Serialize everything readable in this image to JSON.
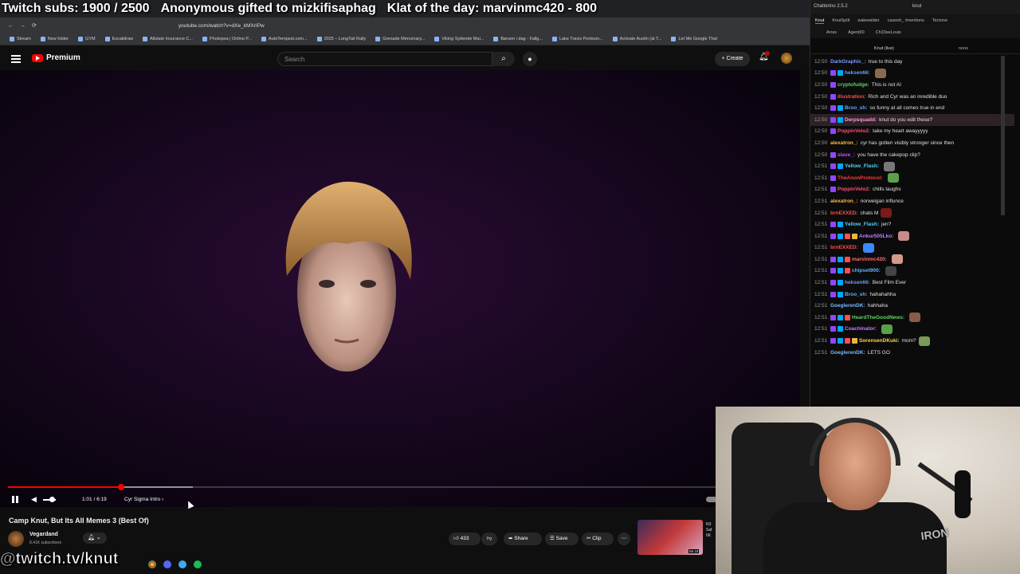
{
  "overlay": {
    "subs": "Twitch subs: 1900 / 2500",
    "gift": "Anonymous gifted to mizkifisaphag",
    "klat": "Klat of the day: marvinmc420 - 800"
  },
  "browser": {
    "url": "youtube.com/watch?v=dXe_kMXrIPw",
    "bookmarks": [
      "Stream",
      "New folder",
      "GYM",
      "Excalidraw",
      "Allstate Insurance C...",
      "Photopea | Online P...",
      "AutoTempest.com...",
      "2025 – LongTail Rally",
      "Grenade Mercenary...",
      "Viking Syttende Mai...",
      "Børsen i dag - Fallg...",
      "Lake Travis Pontoon...",
      "Activate Austin (at T...",
      "Let Me Google That"
    ]
  },
  "youtube": {
    "logo_text": "Premium",
    "search_placeholder": "Search",
    "create_label": "Create",
    "time": "1:01 / 6:19",
    "chapter": "Cyr Sigma Intro",
    "chapter_arrow": "›",
    "progress_fraction": 0.16,
    "title": "Camp Knut, But Its All Memes 3 (Best Of)",
    "channel": "Vegardand",
    "subscribers": "8.41K subscribers",
    "likes": "433",
    "share": "Share",
    "save": "Save",
    "clip": "Clip",
    "next_duration": "55:18",
    "next_label": "N3\nSaf\n6K"
  },
  "watermark": "@twitch.tv/knut",
  "chat": {
    "app_title": "Chatterino 2.5.2",
    "top_channel": "knut",
    "tabs": [
      "Knut",
      "KnutSplit",
      "wakewilder",
      "caseoh_ /mentions",
      "Tectone"
    ],
    "tabs2": [
      "Arrav",
      "Agent00",
      "Ch33seLouis"
    ],
    "channel_label": "Knut (live)",
    "filter_label": "none",
    "lines": [
      {
        "ts": "12:50",
        "name": "DarkGraphic_:",
        "color": "#7a9cff",
        "msg": "true to this day",
        "badges": 0
      },
      {
        "ts": "12:50",
        "name": "heksen66:",
        "color": "#6a9dff",
        "msg": "",
        "badges": 2,
        "emote": "#8a6a4a"
      },
      {
        "ts": "12:50",
        "name": "cryptofudge:",
        "color": "#61d161",
        "msg": "This is not AI",
        "badges": 1
      },
      {
        "ts": "12:50",
        "name": "illustration:",
        "color": "#ff4d4d",
        "msg": "Rich and Cyr was an inredible duo",
        "badges": 1
      },
      {
        "ts": "12:50",
        "name": "Broo_sh:",
        "color": "#5fa8ff",
        "msg": "so funny at all comes true in end",
        "badges": 2
      },
      {
        "ts": "12:50",
        "name": "Derpsquadd:",
        "color": "#ff9ad5",
        "msg": "knut do you edit these?",
        "badges": 2,
        "hl": true
      },
      {
        "ts": "12:50",
        "name": "PoppinVelo2:",
        "color": "#ff4d6d",
        "msg": "take my heart awayyyyy",
        "badges": 1
      },
      {
        "ts": "12:50",
        "name": "alexatron_:",
        "color": "#ffb84d",
        "msg": "cyr has gotten visibly stronger since then",
        "badges": 0
      },
      {
        "ts": "12:50",
        "name": "slave_:",
        "color": "#cc4dff",
        "msg": "you have the cakepop clip?",
        "badges": 1
      },
      {
        "ts": "12:51",
        "name": "Yellow_Flash:",
        "color": "#4dd2ff",
        "msg": "",
        "badges": 2,
        "emote": "#777"
      },
      {
        "ts": "12:51",
        "name": "TheAnonProtocol:",
        "color": "#ff3b3b",
        "msg": "",
        "badges": 1,
        "emote": "#5aa04a"
      },
      {
        "ts": "12:51",
        "name": "PoppinVelo2:",
        "color": "#ff4d6d",
        "msg": "chills laughs",
        "badges": 1
      },
      {
        "ts": "12:51",
        "name": "alexatron_:",
        "color": "#ffb84d",
        "msg": "norweigan influnce",
        "badges": 0
      },
      {
        "ts": "12:51",
        "name": "brnEXXED:",
        "color": "#ff4d4d",
        "msg": "chats M",
        "badges": 0,
        "emote": "#7a1a1a"
      },
      {
        "ts": "12:51",
        "name": "Yellow_Flash:",
        "color": "#4dd2ff",
        "msg": "jen?",
        "badges": 2
      },
      {
        "ts": "12:51",
        "name": "Ankur505Lko:",
        "color": "#c27dff",
        "msg": "",
        "badges": 4,
        "emote": "#c98a8a"
      },
      {
        "ts": "12:51",
        "name": "brnEXXED:",
        "color": "#ff4d4d",
        "msg": "",
        "badges": 0,
        "emote": "#3a8aff"
      },
      {
        "ts": "12:51",
        "name": "marvinmc420:",
        "color": "#ff6b6b",
        "msg": "",
        "badges": 3,
        "emote": "#d49a8a"
      },
      {
        "ts": "12:51",
        "name": "chipset900:",
        "color": "#6ab0ff",
        "msg": "",
        "badges": 3,
        "emote": "#444"
      },
      {
        "ts": "12:51",
        "name": "heksen66:",
        "color": "#6a9dff",
        "msg": "Best Film Ever",
        "badges": 2
      },
      {
        "ts": "12:51",
        "name": "Broo_sh:",
        "color": "#5fa8ff",
        "msg": "hahahahha",
        "badges": 2
      },
      {
        "ts": "12:51",
        "name": "GoeglerenDK:",
        "color": "#7ab8ff",
        "msg": "hahhaha",
        "badges": 0
      },
      {
        "ts": "12:51",
        "name": "HeardTheGoodNews:",
        "color": "#61d161",
        "msg": "",
        "badges": 3,
        "emote": "#8a5a4a"
      },
      {
        "ts": "12:51",
        "name": "Coachinator:",
        "color": "#c27dff",
        "msg": "",
        "badges": 2,
        "emote": "#5aa04a"
      },
      {
        "ts": "12:51",
        "name": "SorensenDKuki:",
        "color": "#ffd34d",
        "msg": "mom?",
        "badges": 4,
        "emote": "#7a9a5a"
      },
      {
        "ts": "12:51",
        "name": "GoeglerenDK:",
        "color": "#7ab8ff",
        "msg": "LETS GO",
        "badges": 0
      }
    ]
  },
  "webcam": {
    "logo": "IRON"
  },
  "colors": {
    "accent_red": "#ff0000",
    "bg": "#0f0f0f"
  }
}
